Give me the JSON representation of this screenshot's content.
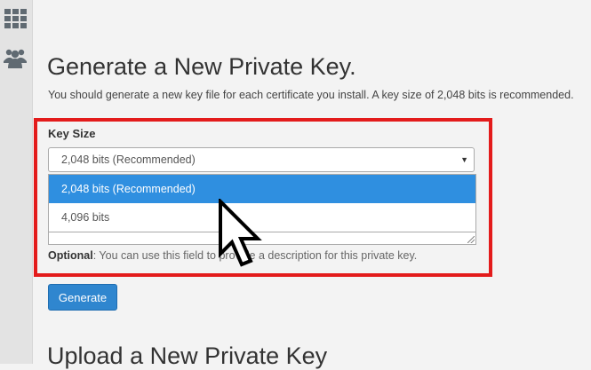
{
  "top_sliver_text": "· · ·",
  "page_title": "Generate a New Private Key.",
  "intro": "You should generate a new key file for each certificate you install. A key size of 2,048 bits is recommended.",
  "key_size": {
    "label": "Key Size",
    "selected": "2,048 bits (Recommended)",
    "arrow": "▼",
    "options": [
      "2,048 bits (Recommended)",
      "4,096 bits"
    ]
  },
  "help": {
    "prefix": "Optional",
    "text": ": You can use this field to provide a description for this private key."
  },
  "generate_label": "Generate",
  "section2_title": "Upload a New Private Key",
  "icons": {
    "sidebar": [
      "grid-icon",
      "users-icon"
    ],
    "pointer": "mouse-cursor-icon"
  },
  "colors": {
    "highlight": "#e31b1b",
    "accent": "#2f8fe0",
    "button": "#2f86cf"
  }
}
